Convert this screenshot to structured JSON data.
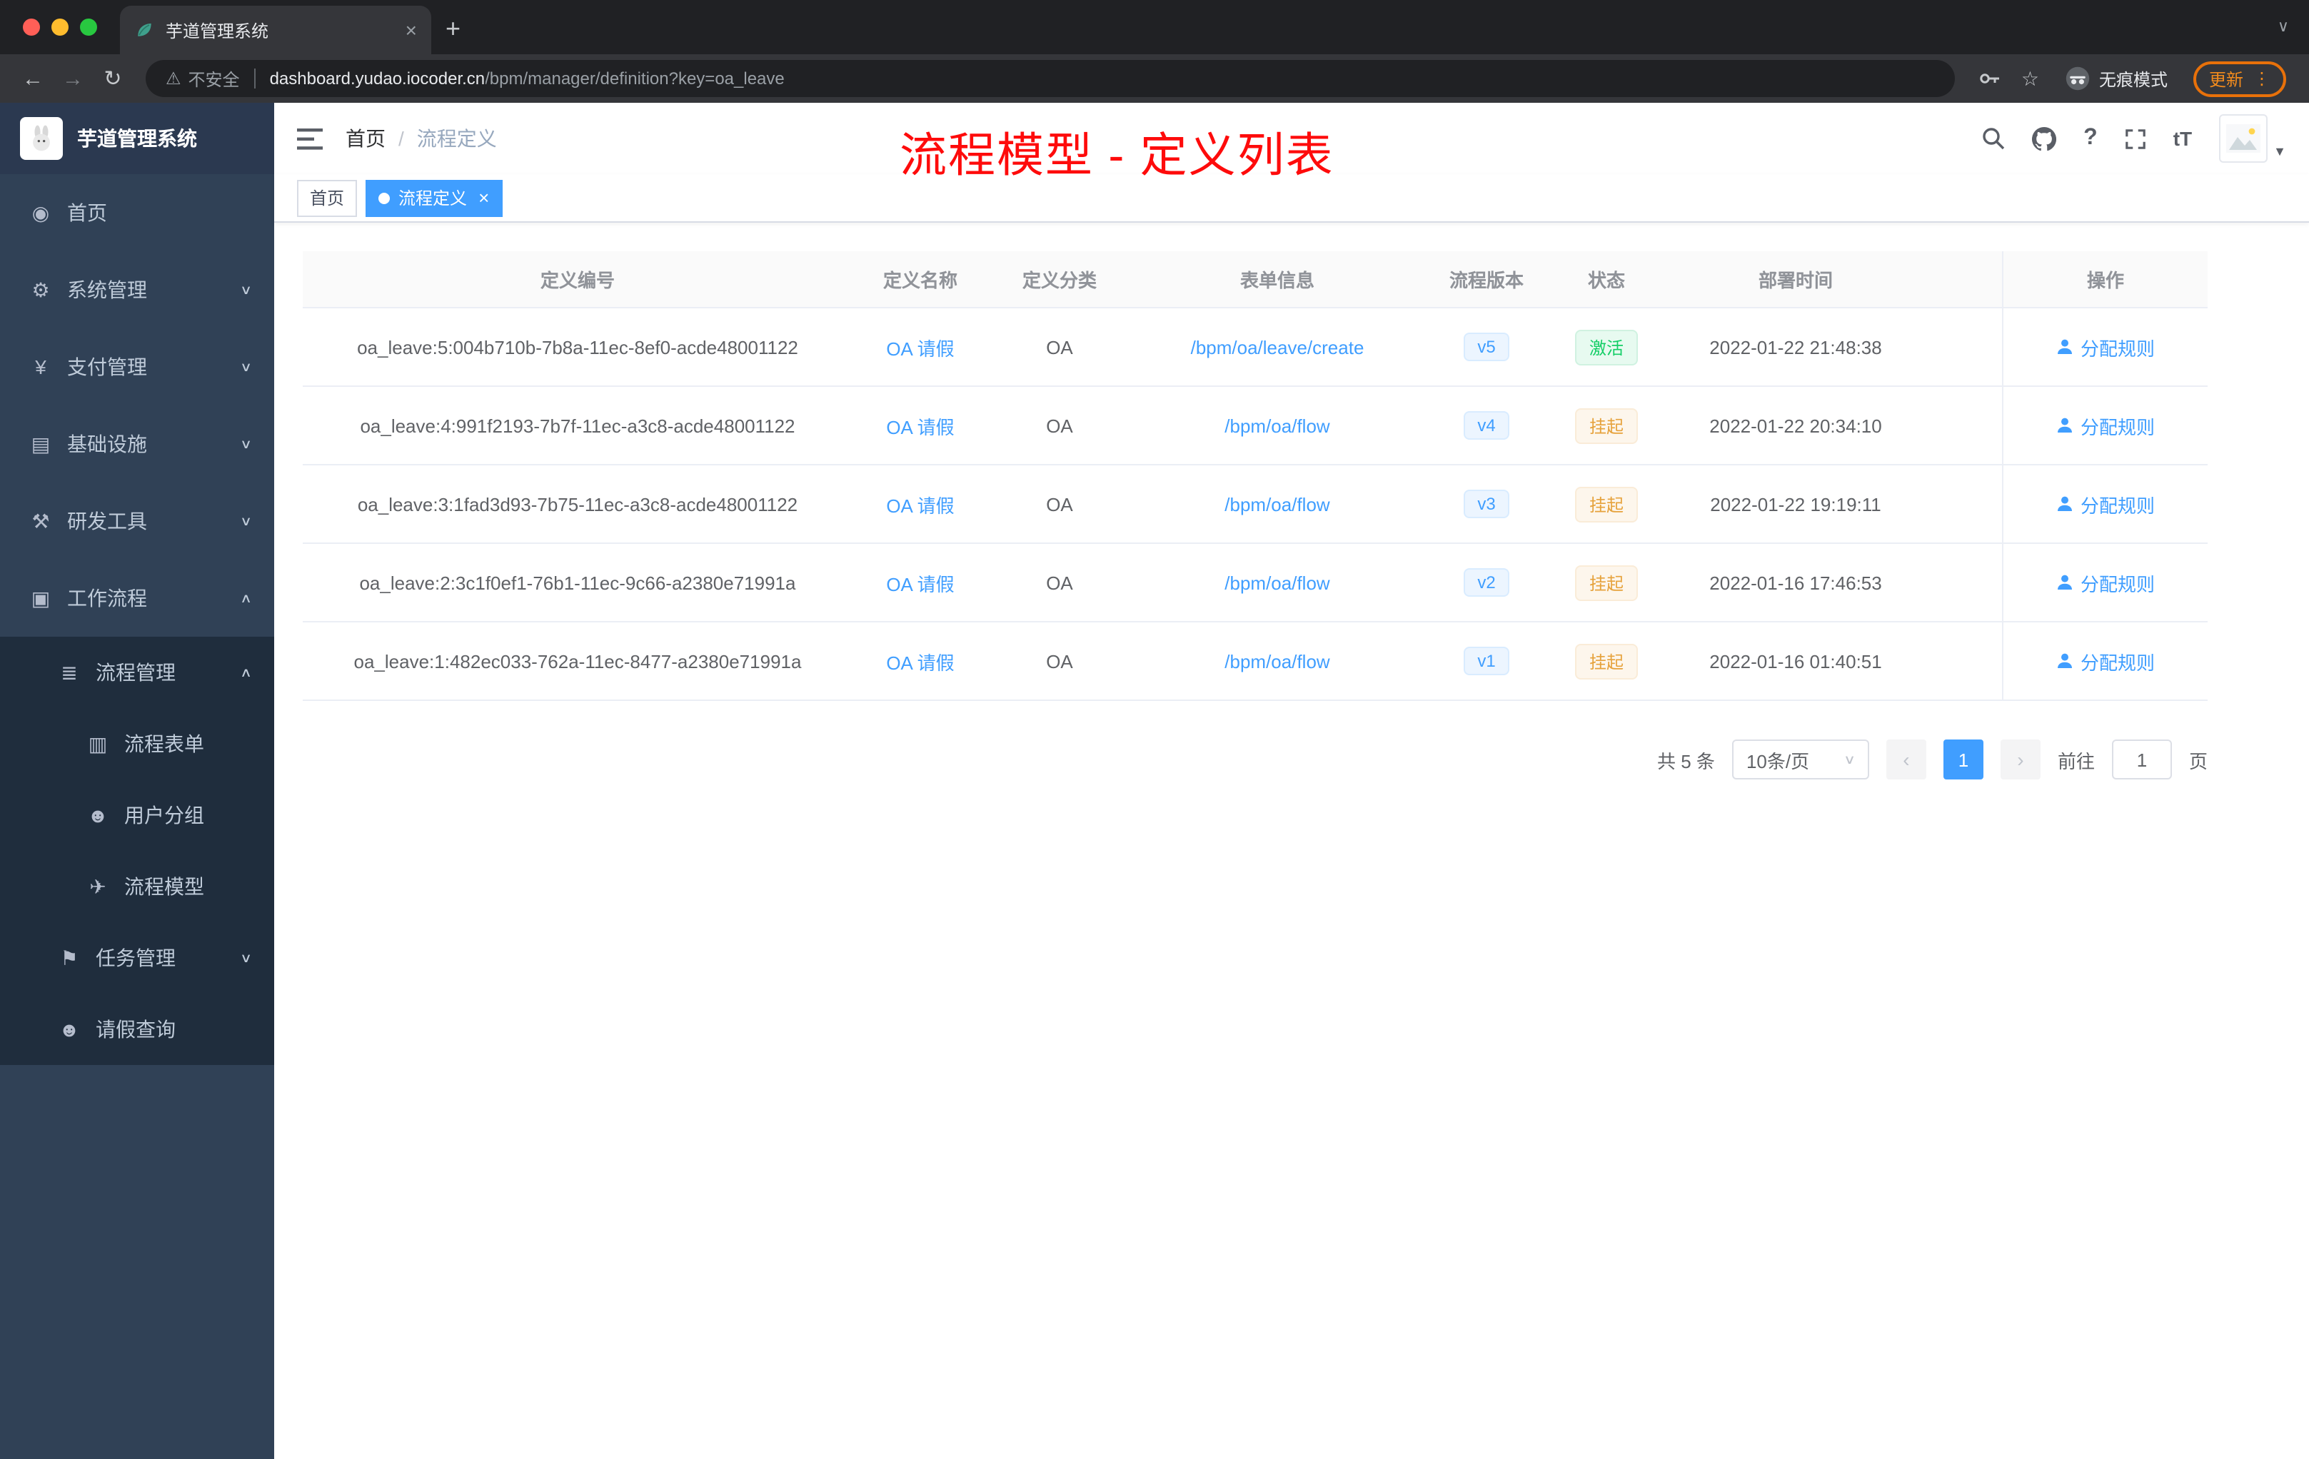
{
  "browser": {
    "tab_title": "芋道管理系统",
    "tab_close": "×",
    "new_tab": "+",
    "security_label": "不安全",
    "url_host": "dashboard.yudao.iocoder.cn",
    "url_path": "/bpm/manager/definition?key=oa_leave",
    "incognito_label": "无痕模式",
    "update_label": "更新"
  },
  "colors": {
    "accent": "#409eff",
    "success": "#13ce66",
    "warning": "#e6a23c",
    "annotation": "#fe0b0b",
    "sidebar_bg": "#304156",
    "submenu_bg": "#1f2d3d"
  },
  "sidebar": {
    "logo_title": "芋道管理系统",
    "items": [
      {
        "label": "首页",
        "glyph": "◉"
      },
      {
        "label": "系统管理",
        "glyph": "⚙"
      },
      {
        "label": "支付管理",
        "glyph": "¥"
      },
      {
        "label": "基础设施",
        "glyph": "▤"
      },
      {
        "label": "研发工具",
        "glyph": "⚒"
      },
      {
        "label": "工作流程",
        "glyph": "▣"
      },
      {
        "label": "流程管理",
        "glyph": "≣"
      },
      {
        "label": "流程表单",
        "glyph": "▥"
      },
      {
        "label": "用户分组",
        "glyph": "☻"
      },
      {
        "label": "流程模型",
        "glyph": "✈"
      },
      {
        "label": "任务管理",
        "glyph": "⚑"
      },
      {
        "label": "请假查询",
        "glyph": "☻"
      }
    ]
  },
  "header": {
    "breadcrumb_home": "首页",
    "breadcrumb_sep": "/",
    "breadcrumb_current": "流程定义",
    "annotation": "流程模型 - 定义列表"
  },
  "tags": {
    "home": "首页",
    "active": "流程定义",
    "close": "×"
  },
  "table": {
    "columns": [
      "定义编号",
      "定义名称",
      "定义分类",
      "表单信息",
      "流程版本",
      "状态",
      "部署时间",
      "操作"
    ],
    "rows": [
      {
        "id": "oa_leave:5:004b710b-7b8a-11ec-8ef0-acde48001122",
        "name": "OA 请假",
        "category": "OA",
        "form": "/bpm/oa/leave/create",
        "version": "v5",
        "status": "激活",
        "status_type": "success",
        "time": "2022-01-22 21:48:38",
        "action": "分配规则"
      },
      {
        "id": "oa_leave:4:991f2193-7b7f-11ec-a3c8-acde48001122",
        "name": "OA 请假",
        "category": "OA",
        "form": "/bpm/oa/flow",
        "version": "v4",
        "status": "挂起",
        "status_type": "warning",
        "time": "2022-01-22 20:34:10",
        "action": "分配规则"
      },
      {
        "id": "oa_leave:3:1fad3d93-7b75-11ec-a3c8-acde48001122",
        "name": "OA 请假",
        "category": "OA",
        "form": "/bpm/oa/flow",
        "version": "v3",
        "status": "挂起",
        "status_type": "warning",
        "time": "2022-01-22 19:19:11",
        "action": "分配规则"
      },
      {
        "id": "oa_leave:2:3c1f0ef1-76b1-11ec-9c66-a2380e71991a",
        "name": "OA 请假",
        "category": "OA",
        "form": "/bpm/oa/flow",
        "version": "v2",
        "status": "挂起",
        "status_type": "warning",
        "time": "2022-01-16 17:46:53",
        "action": "分配规则"
      },
      {
        "id": "oa_leave:1:482ec033-762a-11ec-8477-a2380e71991a",
        "name": "OA 请假",
        "category": "OA",
        "form": "/bpm/oa/flow",
        "version": "v1",
        "status": "挂起",
        "status_type": "warning",
        "time": "2022-01-16 01:40:51",
        "action": "分配规则"
      }
    ]
  },
  "pagination": {
    "total": "共 5 条",
    "page_size": "10条/页",
    "prev": "‹",
    "page": "1",
    "next": "›",
    "goto_label": "前往",
    "goto_value": "1",
    "goto_unit": "页"
  }
}
